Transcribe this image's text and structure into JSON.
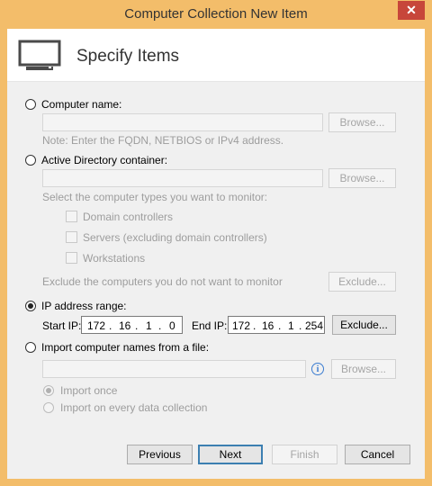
{
  "window": {
    "title": "Computer Collection New Item",
    "close_glyph": "✕"
  },
  "header": {
    "title": "Specify Items",
    "icon": "monitor-icon"
  },
  "computer_name": {
    "label": "Computer name:",
    "browse": "Browse...",
    "note": "Note: Enter the FQDN, NETBIOS or IPv4 address.",
    "selected": false
  },
  "ad_container": {
    "label": "Active Directory container:",
    "browse": "Browse...",
    "types_label": "Select the computer types you want to monitor:",
    "types": [
      "Domain controllers",
      "Servers (excluding domain controllers)",
      "Workstations"
    ],
    "exclude_label": "Exclude the computers you do not want to monitor",
    "exclude_button": "Exclude...",
    "selected": false
  },
  "ip_range": {
    "label": "IP address range:",
    "start_label": "Start IP:",
    "start": [
      "172",
      "16",
      "1",
      "0"
    ],
    "end_label": "End IP:",
    "end": [
      "172",
      "16",
      "1",
      "254"
    ],
    "exclude_button": "Exclude...",
    "selected": true
  },
  "import_file": {
    "label": "Import computer names from a file:",
    "browse": "Browse...",
    "options": [
      "Import once",
      "Import on every data collection"
    ],
    "selected": false
  },
  "footer": {
    "previous": "Previous",
    "next": "Next",
    "finish": "Finish",
    "cancel": "Cancel"
  }
}
